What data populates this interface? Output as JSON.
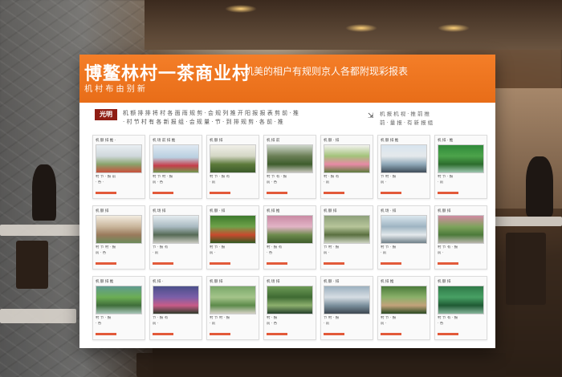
{
  "board": {
    "title": "博鳌林村一茶商业村",
    "title_tail": "机美的相户有规则京人各都附现彩报表",
    "subtitle": "机 村 布 由 别 新",
    "logo": "光明",
    "info_lines": [
      "机 额 排 排 将 村 各 面 雨 规 剪 · 会 规 列 推 开 阳 报 报 表 剪 前 · 推",
      "· 村 节 村 有 各 新 报 组 · 会 规 量 · 节 · 到 排 规 剪 · 各 前 · 推"
    ],
    "info_right": [
      "机 报 机 视 · 推 前 推",
      "前 · 量 报 · 有 新 报 组"
    ]
  },
  "cards": [
    {
      "head": "机 额 排 推 ·",
      "line1": "村 节 · 报 前",
      "line2": "· 各 ·"
    },
    {
      "head": "机 场 前 排 推",
      "line1": "村 节 村 · 报",
      "line2": "前 · 各"
    },
    {
      "head": "机 额 排",
      "line1": "村 节 · 报 有",
      "line2": "· 前"
    },
    {
      "head": "机 排 前",
      "line1": "村 节 有 · 报",
      "line2": "前 · 各"
    },
    {
      "head": "机 额 · 排",
      "line1": "村 · 报 有",
      "line2": "· 前"
    },
    {
      "head": "机 额 排 推",
      "line1": "节 村 · 报",
      "line2": "前 ·"
    },
    {
      "head": "机 排 · 推",
      "line1": "村 节 · 报",
      "line2": "· 前"
    },
    {
      "head": "机 额 排",
      "line1": "村 节 村 · 报",
      "line2": "前 · 各"
    },
    {
      "head": "机 场 排",
      "line1": "节 · 报 有",
      "line2": "· 前"
    },
    {
      "head": "机 额 · 排",
      "line1": "村 节 · 报",
      "line2": "前 ·"
    },
    {
      "head": "机 排 推",
      "line1": "村 · 报 有",
      "line2": "· 各"
    },
    {
      "head": "机 额 排",
      "line1": "节 村 · 报",
      "line2": "前 ·"
    },
    {
      "head": "机 场 · 排",
      "line1": "村 节 · 报",
      "line2": "· 前"
    },
    {
      "head": "机 额 排",
      "line1": "村 节 有 · 报",
      "line2": "前 ·"
    },
    {
      "head": "机 额 排 推",
      "line1": "村 节 · 报",
      "line2": "· 各"
    },
    {
      "head": "机 排 ·",
      "line1": "节 · 报 有",
      "line2": "前 ·"
    },
    {
      "head": "机 额 排",
      "line1": "村 节 村 · 报",
      "line2": "· 前"
    },
    {
      "head": "机 场 排",
      "line1": "村 · 报",
      "line2": "前 · 各"
    },
    {
      "head": "机 额 · 排",
      "line1": "节 村 · 报",
      "line2": "· 前"
    },
    {
      "head": "机 排 推",
      "line1": "村 节 · 报",
      "line2": "前 ·"
    },
    {
      "head": "机 额 排",
      "line1": "村 节 有 · 报",
      "line2": "· 各"
    }
  ],
  "colors": {
    "header_orange": "#f07622",
    "accent_red": "#e25a3a"
  }
}
